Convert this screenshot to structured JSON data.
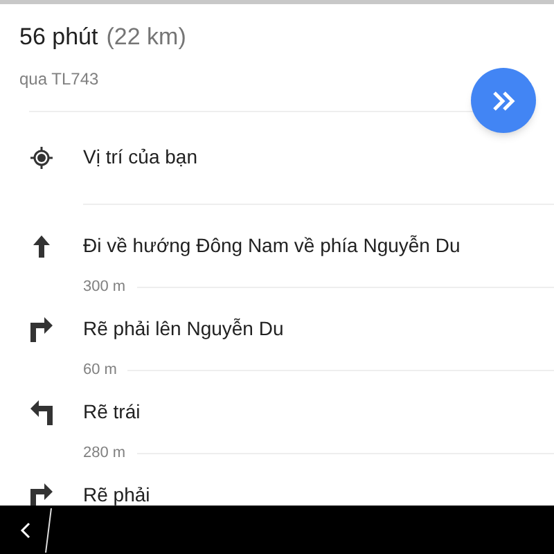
{
  "summary": {
    "duration": "56 phút",
    "distance": "(22 km)",
    "via": "qua TL743"
  },
  "origin": {
    "label": "Vị trí của bạn"
  },
  "steps": [
    {
      "kind": "straight",
      "instruction": "Đi về hướng Đông Nam về phía Nguyễn Du",
      "distance": "300 m"
    },
    {
      "kind": "right",
      "instruction": "Rẽ phải lên Nguyễn Du",
      "distance": "60 m"
    },
    {
      "kind": "left",
      "instruction": "Rẽ trái",
      "distance": "280 m"
    },
    {
      "kind": "right",
      "instruction": "Rẽ phải"
    }
  ]
}
